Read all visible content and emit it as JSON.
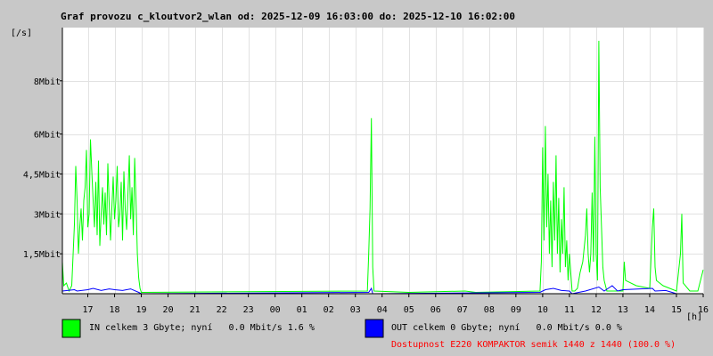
{
  "chart_data": {
    "type": "area",
    "title": "Graf provozu c_kloutvor2_wlan od: 2025-12-09 16:03:00 do: 2025-12-10 16:02:00",
    "unit_label": "[/s]",
    "x_unit_label": "[h]",
    "ylim": [
      0,
      10
    ],
    "y_ticks": [
      {
        "value": 1.5,
        "label": "1,5Mbit"
      },
      {
        "value": 3,
        "label": "3Mbit"
      },
      {
        "value": 4.5,
        "label": "4,5Mbit"
      },
      {
        "value": 6,
        "label": "6Mbit"
      },
      {
        "value": 8,
        "label": "8Mbit"
      }
    ],
    "xlim": [
      16.05,
      40.0
    ],
    "x_ticks": [
      {
        "value": 17,
        "label": "17"
      },
      {
        "value": 18,
        "label": "18"
      },
      {
        "value": 19,
        "label": "19"
      },
      {
        "value": 20,
        "label": "20"
      },
      {
        "value": 21,
        "label": "21"
      },
      {
        "value": 22,
        "label": "22"
      },
      {
        "value": 23,
        "label": "23"
      },
      {
        "value": 24,
        "label": "00"
      },
      {
        "value": 25,
        "label": "01"
      },
      {
        "value": 26,
        "label": "02"
      },
      {
        "value": 27,
        "label": "03"
      },
      {
        "value": 28,
        "label": "04"
      },
      {
        "value": 29,
        "label": "05"
      },
      {
        "value": 30,
        "label": "06"
      },
      {
        "value": 31,
        "label": "07"
      },
      {
        "value": 32,
        "label": "08"
      },
      {
        "value": 33,
        "label": "09"
      },
      {
        "value": 34,
        "label": "10"
      },
      {
        "value": 35,
        "label": "11"
      },
      {
        "value": 36,
        "label": "12"
      },
      {
        "value": 37,
        "label": "13"
      },
      {
        "value": 38,
        "label": "14"
      },
      {
        "value": 39,
        "label": "15"
      },
      {
        "value": 40,
        "label": "16"
      }
    ],
    "grid": true,
    "series": [
      {
        "name": "IN",
        "color": "#00ff00",
        "points": [
          [
            16.05,
            1.2
          ],
          [
            16.1,
            0.3
          ],
          [
            16.2,
            0.4
          ],
          [
            16.3,
            0.1
          ],
          [
            16.4,
            0.3
          ],
          [
            16.5,
            2.6
          ],
          [
            16.55,
            4.8
          ],
          [
            16.6,
            3.5
          ],
          [
            16.65,
            1.5
          ],
          [
            16.7,
            2.5
          ],
          [
            16.75,
            3.2
          ],
          [
            16.8,
            2.0
          ],
          [
            16.85,
            3.5
          ],
          [
            16.9,
            4.0
          ],
          [
            16.95,
            5.4
          ],
          [
            17.0,
            2.5
          ],
          [
            17.05,
            3.0
          ],
          [
            17.1,
            5.8
          ],
          [
            17.15,
            4.6
          ],
          [
            17.2,
            3.5
          ],
          [
            17.25,
            2.5
          ],
          [
            17.3,
            4.2
          ],
          [
            17.35,
            2.2
          ],
          [
            17.4,
            5.0
          ],
          [
            17.45,
            1.8
          ],
          [
            17.5,
            3.0
          ],
          [
            17.55,
            4.0
          ],
          [
            17.6,
            2.6
          ],
          [
            17.65,
            3.8
          ],
          [
            17.7,
            2.2
          ],
          [
            17.75,
            4.9
          ],
          [
            17.8,
            3.4
          ],
          [
            17.85,
            2.0
          ],
          [
            17.9,
            3.2
          ],
          [
            17.95,
            4.4
          ],
          [
            18.0,
            2.8
          ],
          [
            18.05,
            3.5
          ],
          [
            18.1,
            4.8
          ],
          [
            18.15,
            2.5
          ],
          [
            18.2,
            3.0
          ],
          [
            18.25,
            4.2
          ],
          [
            18.3,
            2.0
          ],
          [
            18.35,
            4.6
          ],
          [
            18.4,
            3.2
          ],
          [
            18.45,
            2.4
          ],
          [
            18.5,
            3.8
          ],
          [
            18.55,
            5.2
          ],
          [
            18.6,
            2.8
          ],
          [
            18.65,
            4.0
          ],
          [
            18.7,
            2.2
          ],
          [
            18.75,
            5.1
          ],
          [
            18.8,
            3.5
          ],
          [
            18.85,
            1.5
          ],
          [
            18.9,
            0.6
          ],
          [
            18.95,
            0.2
          ],
          [
            19.0,
            0.05
          ],
          [
            27.45,
            0.1
          ],
          [
            27.5,
            1.5
          ],
          [
            27.55,
            3.2
          ],
          [
            27.6,
            6.6
          ],
          [
            27.65,
            1.0
          ],
          [
            27.7,
            0.1
          ],
          [
            29.0,
            0.05
          ],
          [
            31.1,
            0.1
          ],
          [
            31.5,
            0.05
          ],
          [
            33.9,
            0.1
          ],
          [
            33.95,
            1.2
          ],
          [
            34.0,
            5.5
          ],
          [
            34.05,
            2.0
          ],
          [
            34.1,
            6.3
          ],
          [
            34.15,
            2.5
          ],
          [
            34.2,
            4.5
          ],
          [
            34.25,
            1.5
          ],
          [
            34.3,
            3.5
          ],
          [
            34.35,
            1.0
          ],
          [
            34.4,
            4.2
          ],
          [
            34.45,
            2.0
          ],
          [
            34.5,
            5.2
          ],
          [
            34.55,
            1.5
          ],
          [
            34.6,
            3.6
          ],
          [
            34.65,
            0.8
          ],
          [
            34.7,
            2.8
          ],
          [
            34.75,
            1.5
          ],
          [
            34.8,
            4.0
          ],
          [
            34.85,
            1.0
          ],
          [
            34.9,
            2.0
          ],
          [
            34.95,
            0.5
          ],
          [
            35.0,
            1.5
          ],
          [
            35.05,
            0.8
          ],
          [
            35.1,
            0.1
          ],
          [
            35.2,
            0.1
          ],
          [
            35.3,
            0.2
          ],
          [
            35.4,
            0.8
          ],
          [
            35.5,
            1.2
          ],
          [
            35.6,
            2.2
          ],
          [
            35.65,
            3.2
          ],
          [
            35.7,
            1.5
          ],
          [
            35.75,
            0.8
          ],
          [
            35.8,
            1.5
          ],
          [
            35.85,
            3.8
          ],
          [
            35.9,
            1.2
          ],
          [
            35.95,
            5.9
          ],
          [
            36.0,
            1.5
          ],
          [
            36.05,
            0.5
          ],
          [
            36.1,
            9.5
          ],
          [
            36.15,
            4.0
          ],
          [
            36.2,
            2.5
          ],
          [
            36.25,
            1.0
          ],
          [
            36.3,
            0.5
          ],
          [
            36.4,
            0.1
          ],
          [
            37.0,
            0.1
          ],
          [
            37.05,
            1.2
          ],
          [
            37.1,
            0.5
          ],
          [
            37.5,
            0.3
          ],
          [
            38.0,
            0.2
          ],
          [
            38.1,
            2.5
          ],
          [
            38.15,
            3.2
          ],
          [
            38.2,
            1.0
          ],
          [
            38.25,
            0.5
          ],
          [
            38.5,
            0.3
          ],
          [
            39.0,
            0.1
          ],
          [
            39.15,
            1.5
          ],
          [
            39.2,
            3.0
          ],
          [
            39.25,
            0.4
          ],
          [
            39.5,
            0.1
          ],
          [
            39.8,
            0.1
          ],
          [
            40.0,
            0.9
          ]
        ]
      },
      {
        "name": "OUT",
        "color": "#0000ff",
        "points": [
          [
            16.05,
            0.1
          ],
          [
            16.5,
            0.15
          ],
          [
            16.6,
            0.1
          ],
          [
            17.0,
            0.15
          ],
          [
            17.2,
            0.2
          ],
          [
            17.5,
            0.12
          ],
          [
            17.8,
            0.18
          ],
          [
            18.0,
            0.15
          ],
          [
            18.3,
            0.12
          ],
          [
            18.6,
            0.18
          ],
          [
            18.9,
            0.05
          ],
          [
            19.0,
            0.0
          ],
          [
            27.5,
            0.05
          ],
          [
            27.6,
            0.2
          ],
          [
            27.65,
            0.0
          ],
          [
            33.9,
            0.05
          ],
          [
            34.1,
            0.15
          ],
          [
            34.4,
            0.2
          ],
          [
            34.7,
            0.12
          ],
          [
            35.0,
            0.1
          ],
          [
            35.1,
            0.0
          ],
          [
            35.6,
            0.1
          ],
          [
            36.1,
            0.25
          ],
          [
            36.3,
            0.1
          ],
          [
            36.6,
            0.3
          ],
          [
            36.8,
            0.1
          ],
          [
            37.0,
            0.15
          ],
          [
            38.1,
            0.2
          ],
          [
            38.2,
            0.1
          ],
          [
            38.6,
            0.12
          ],
          [
            39.0,
            0.0
          ]
        ]
      }
    ]
  },
  "legend": {
    "in_text": "IN celkem 3 Gbyte; nyní   0.0 Mbit/s 1.6 %",
    "in_color": "#00ff00",
    "out_text": "OUT celkem 0 Gbyte; nyní   0.0 Mbit/s 0.0 %",
    "out_color": "#0000ff",
    "availability_text": "Dostupnost E220 KOMPAKTOR semik 1440 z 1440 (100.0 %)",
    "availability_color": "#ff0000"
  }
}
